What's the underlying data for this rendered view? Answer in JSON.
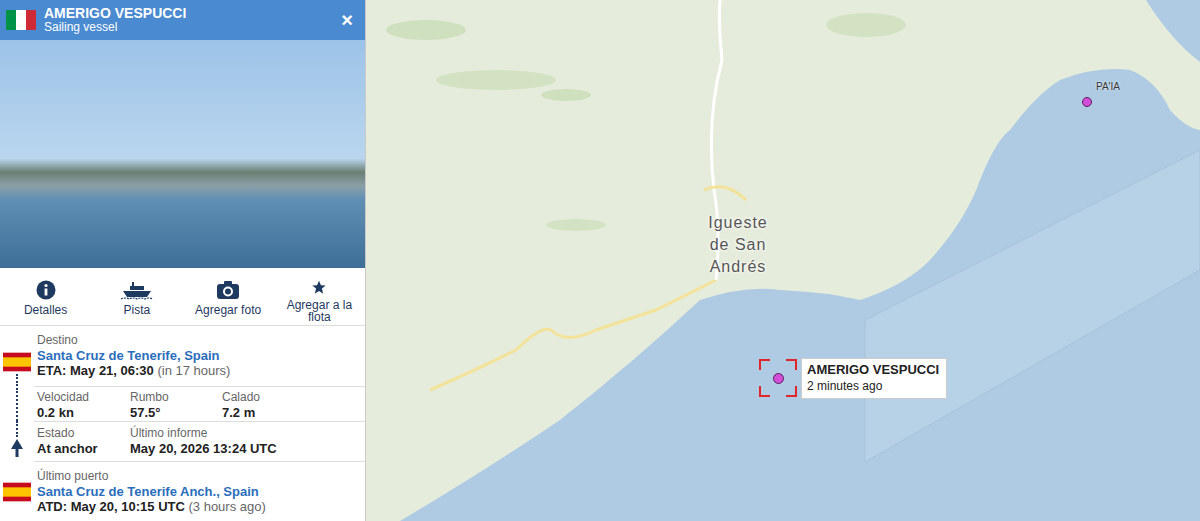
{
  "vessel": {
    "name": "AMERIGO VESPUCCI",
    "type": "Sailing vessel",
    "close": "×"
  },
  "actions": [
    {
      "label": "Detalles",
      "kind": "info"
    },
    {
      "label": "Pista",
      "kind": "track"
    },
    {
      "label": "Agregar foto",
      "kind": "photo"
    },
    {
      "label": "Agregar a la flota",
      "kind": "fleet"
    }
  ],
  "destination": {
    "label": "Destino",
    "port": "Santa Cruz de Tenerife, Spain",
    "eta": "ETA: May 21, 06:30",
    "eta_relative": "(in 17 hours)"
  },
  "stats": [
    {
      "label": "Velocidad",
      "value": "0.2 kn"
    },
    {
      "label": "Rumbo",
      "value": "57.5°"
    },
    {
      "label": "Calado",
      "value": "7.2 m"
    }
  ],
  "status": [
    {
      "label": "Estado",
      "value": "At anchor"
    },
    {
      "label": "Último informe",
      "value": "May 20, 2026 13:24 UTC"
    }
  ],
  "last_port": {
    "label": "Último puerto",
    "port": "Santa Cruz de Tenerife Anch., Spain",
    "atd": "ATD: May 20, 10:15 UTC",
    "atd_relative": "(3 hours ago)"
  },
  "map": {
    "town": [
      "Igueste",
      "de San",
      "Andrés"
    ],
    "vessels": [
      {
        "name": "AMERIGO VESPUCCI",
        "age": "2 minutes ago",
        "selected": true
      },
      {
        "name": "PA'IA",
        "age": "",
        "selected": false
      }
    ]
  }
}
